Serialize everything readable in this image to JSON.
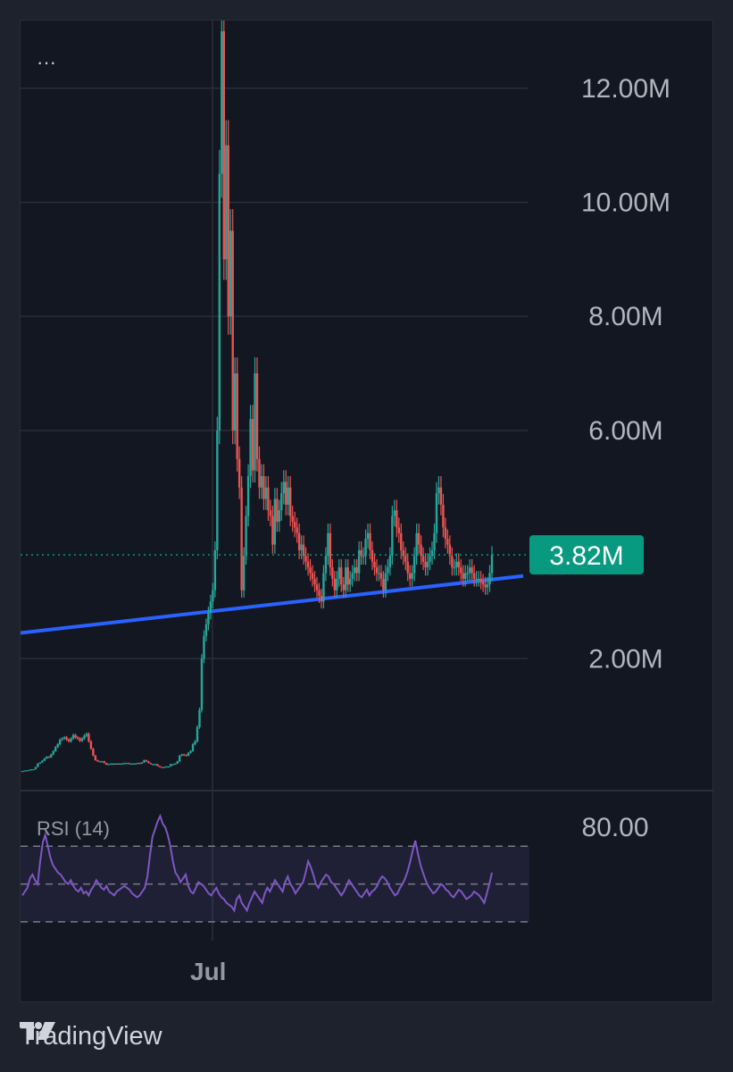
{
  "menu": {
    "dots": "···"
  },
  "brand": {
    "name": "TradingView",
    "logo_icon": "tradingview-logo-icon"
  },
  "colors": {
    "background": "#131722",
    "up": "#26a69a",
    "down": "#ef5350",
    "trendline": "#2962ff",
    "rsi": "#7e57c2",
    "last_price_badge": "#089981"
  },
  "chart_data": [
    {
      "type": "candlestick",
      "x_axis": {
        "labels": [
          "Jul"
        ]
      },
      "y_axis": {
        "side": "right",
        "range": [
          0,
          13500000
        ],
        "ticks": [
          "2.00M",
          "6.00M",
          "8.00M",
          "10.00M",
          "12.00M"
        ],
        "tick_values": [
          2000000,
          6000000,
          8000000,
          10000000,
          12000000
        ],
        "grid": true
      },
      "last_value_label": "3.82M",
      "last_value": 3820000,
      "close_approx": [
        0.03,
        0.04,
        0.04,
        0.05,
        0.06,
        0.06,
        0.1,
        0.16,
        0.18,
        0.21,
        0.25,
        0.28,
        0.27,
        0.32,
        0.38,
        0.45,
        0.5,
        0.58,
        0.6,
        0.62,
        0.58,
        0.55,
        0.6,
        0.66,
        0.62,
        0.6,
        0.56,
        0.6,
        0.65,
        0.68,
        0.55,
        0.42,
        0.3,
        0.22,
        0.2,
        0.2,
        0.2,
        0.17,
        0.14,
        0.15,
        0.16,
        0.16,
        0.16,
        0.15,
        0.16,
        0.16,
        0.17,
        0.17,
        0.16,
        0.16,
        0.16,
        0.16,
        0.17,
        0.16,
        0.18,
        0.22,
        0.2,
        0.17,
        0.15,
        0.15,
        0.15,
        0.12,
        0.1,
        0.09,
        0.1,
        0.11,
        0.11,
        0.15,
        0.15,
        0.16,
        0.2,
        0.3,
        0.32,
        0.31,
        0.3,
        0.35,
        0.38,
        0.5,
        0.55,
        0.8,
        1.1,
        2.0,
        2.4,
        2.6,
        2.8,
        3.0,
        3.2,
        3.9,
        6.0,
        10.5,
        13.0,
        9.0,
        11.0,
        8.0,
        9.5,
        6.0,
        7.0,
        5.5,
        5.0,
        3.2,
        3.8,
        4.5,
        5.2,
        6.2,
        5.3,
        7.0,
        5.5,
        5.0,
        5.2,
        4.8,
        5.0,
        4.6,
        4.5,
        4.0,
        4.8,
        4.4,
        4.6,
        4.9,
        5.1,
        4.7,
        5.0,
        4.5,
        4.4,
        4.3,
        4.2,
        3.9,
        4.0,
        3.8,
        3.7,
        3.6,
        3.5,
        3.4,
        3.3,
        3.2,
        3.1,
        3.0,
        3.5,
        3.8,
        4.2,
        3.6,
        3.4,
        3.2,
        3.4,
        3.6,
        3.3,
        3.2,
        3.6,
        3.3,
        3.4,
        3.5,
        3.6,
        3.5,
        3.9,
        3.8,
        3.8,
        4.1,
        4.2,
        3.9,
        3.7,
        3.6,
        3.5,
        3.5,
        3.4,
        3.2,
        3.5,
        3.6,
        3.8,
        4.5,
        4.6,
        4.3,
        4.2,
        3.9,
        3.8,
        3.7,
        3.5,
        3.4,
        3.5,
        3.8,
        4.2,
        4.0,
        3.8,
        3.7,
        3.6,
        3.7,
        3.8,
        3.9,
        4.2,
        4.9,
        5.0,
        4.7,
        4.3,
        4.1,
        4.0,
        3.8,
        3.6,
        3.6,
        3.7,
        3.6,
        3.5,
        3.4,
        3.5,
        3.5,
        3.6,
        3.5,
        3.4,
        3.4,
        3.4,
        3.35,
        3.3,
        3.25,
        3.3,
        3.5,
        3.82
      ],
      "trendline": {
        "start": 2450000,
        "end": 3450000,
        "color": "#2962ff"
      }
    },
    {
      "type": "line",
      "title": "RSI (14)",
      "y_axis": {
        "range": [
          20,
          90
        ],
        "ticks": [
          "80.00"
        ],
        "tick_values": [
          80
        ]
      },
      "bands": [
        70,
        50,
        30
      ],
      "values": [
        44,
        46,
        48,
        53,
        55,
        52,
        50,
        62,
        72,
        76,
        70,
        64,
        60,
        58,
        56,
        55,
        53,
        51,
        50,
        52,
        49,
        47,
        46,
        48,
        45,
        46,
        44,
        47,
        49,
        52,
        50,
        48,
        47,
        49,
        46,
        45,
        44,
        46,
        47,
        48,
        49,
        48,
        47,
        45,
        44,
        43,
        44,
        46,
        48,
        54,
        65,
        75,
        79,
        83,
        86,
        82,
        80,
        76,
        70,
        62,
        56,
        54,
        51,
        53,
        55,
        49,
        46,
        45,
        48,
        51,
        50,
        49,
        47,
        45,
        44,
        46,
        48,
        45,
        43,
        42,
        40,
        39,
        38,
        36,
        42,
        44,
        40,
        38,
        36,
        40,
        43,
        46,
        44,
        42,
        40,
        45,
        48,
        46,
        49,
        52,
        50,
        48,
        46,
        51,
        54,
        50,
        48,
        45,
        47,
        49,
        51,
        56,
        62,
        59,
        55,
        50,
        48,
        51,
        53,
        55,
        54,
        51,
        50,
        48,
        46,
        44,
        46,
        49,
        52,
        50,
        48,
        46,
        44,
        43,
        45,
        47,
        44,
        46,
        47,
        49,
        52,
        54,
        53,
        51,
        48,
        46,
        44,
        45,
        48,
        50,
        53,
        57,
        62,
        68,
        73,
        66,
        60,
        56,
        52,
        49,
        47,
        45,
        46,
        48,
        50,
        49,
        47,
        46,
        44,
        43,
        45,
        47,
        46,
        44,
        42,
        43,
        44,
        46,
        45,
        44,
        42,
        40,
        45,
        50,
        56
      ]
    }
  ]
}
